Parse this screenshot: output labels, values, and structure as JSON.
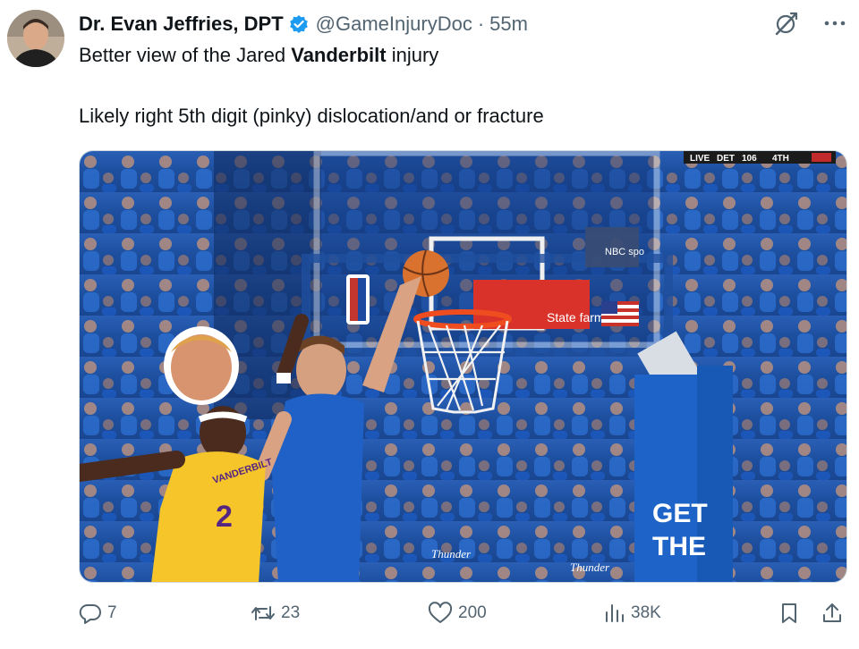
{
  "tweet": {
    "author_name": "Dr. Evan Jeffries, DPT",
    "handle": "@GameInjuryDoc",
    "separator": "·",
    "time": "55m",
    "text_line1_pre": "Better view of the Jared ",
    "text_line1_bold": "Vanderbilt",
    "text_line1_post": " injury",
    "text_line2": "Likely right 5th digit (pinky) dislocation/and or fracture"
  },
  "media": {
    "scoreboard_live": "LIVE",
    "scoreboard_team": "DET",
    "scoreboard_score": "106",
    "scoreboard_quarter": "4TH",
    "jersey_name": "VANDERBILT",
    "jersey_number": "2",
    "banner_text": "State farm",
    "board_text": "NBC spo",
    "sign_line1": "GET",
    "sign_line2": "THE",
    "shirt_text": "Thunder",
    "colors": {
      "crowd_blue": "#1b57b8",
      "thunder_blue": "#1f61c7",
      "lakers_gold": "#f6c52a",
      "rim_orange": "#ef4d1f",
      "ball_orange": "#d9722f"
    }
  },
  "actions": {
    "replies": "7",
    "reposts": "23",
    "likes": "200",
    "views": "38K"
  },
  "icons": {
    "verified": "verified-badge-icon",
    "grok": "grok-icon",
    "more": "more-icon",
    "reply": "reply-icon",
    "repost": "repost-icon",
    "like": "heart-icon",
    "views": "views-icon",
    "bookmark": "bookmark-icon",
    "share": "share-icon"
  },
  "colors": {
    "text_primary": "#0f1419",
    "text_secondary": "#536471",
    "verified_blue": "#1d9bf0"
  }
}
